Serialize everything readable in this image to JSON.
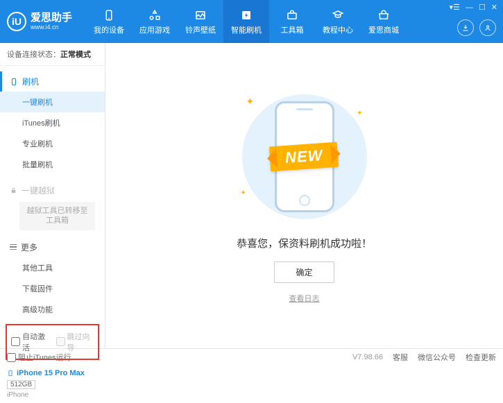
{
  "app": {
    "title": "爱思助手",
    "subtitle": "www.i4.cn",
    "logo_letter": "iU"
  },
  "nav": [
    {
      "label": "我的设备"
    },
    {
      "label": "应用游戏"
    },
    {
      "label": "铃声壁纸"
    },
    {
      "label": "智能刷机"
    },
    {
      "label": "工具箱"
    },
    {
      "label": "教程中心"
    },
    {
      "label": "爱思商城"
    }
  ],
  "status": {
    "label": "设备连接状态：",
    "value": "正常模式"
  },
  "sidebar": {
    "flash": {
      "head": "刷机",
      "items": [
        "一键刷机",
        "iTunes刷机",
        "专业刷机",
        "批量刷机"
      ]
    },
    "jailbreak": {
      "head": "一键越狱",
      "moved": "越狱工具已转移至工具箱"
    },
    "more": {
      "head": "更多",
      "items": [
        "其他工具",
        "下载固件",
        "高级功能"
      ]
    }
  },
  "checkboxes": {
    "auto_activate": "自动激活",
    "skip_guide": "跳过向导"
  },
  "device": {
    "name": "iPhone 15 Pro Max",
    "storage": "512GB",
    "type": "iPhone"
  },
  "main": {
    "ribbon": "NEW",
    "message": "恭喜您，保资料刷机成功啦！",
    "ok": "确定",
    "log": "查看日志"
  },
  "footer": {
    "block_itunes": "阻止iTunes运行",
    "version": "V7.98.66",
    "links": [
      "客服",
      "微信公众号",
      "检查更新"
    ]
  }
}
